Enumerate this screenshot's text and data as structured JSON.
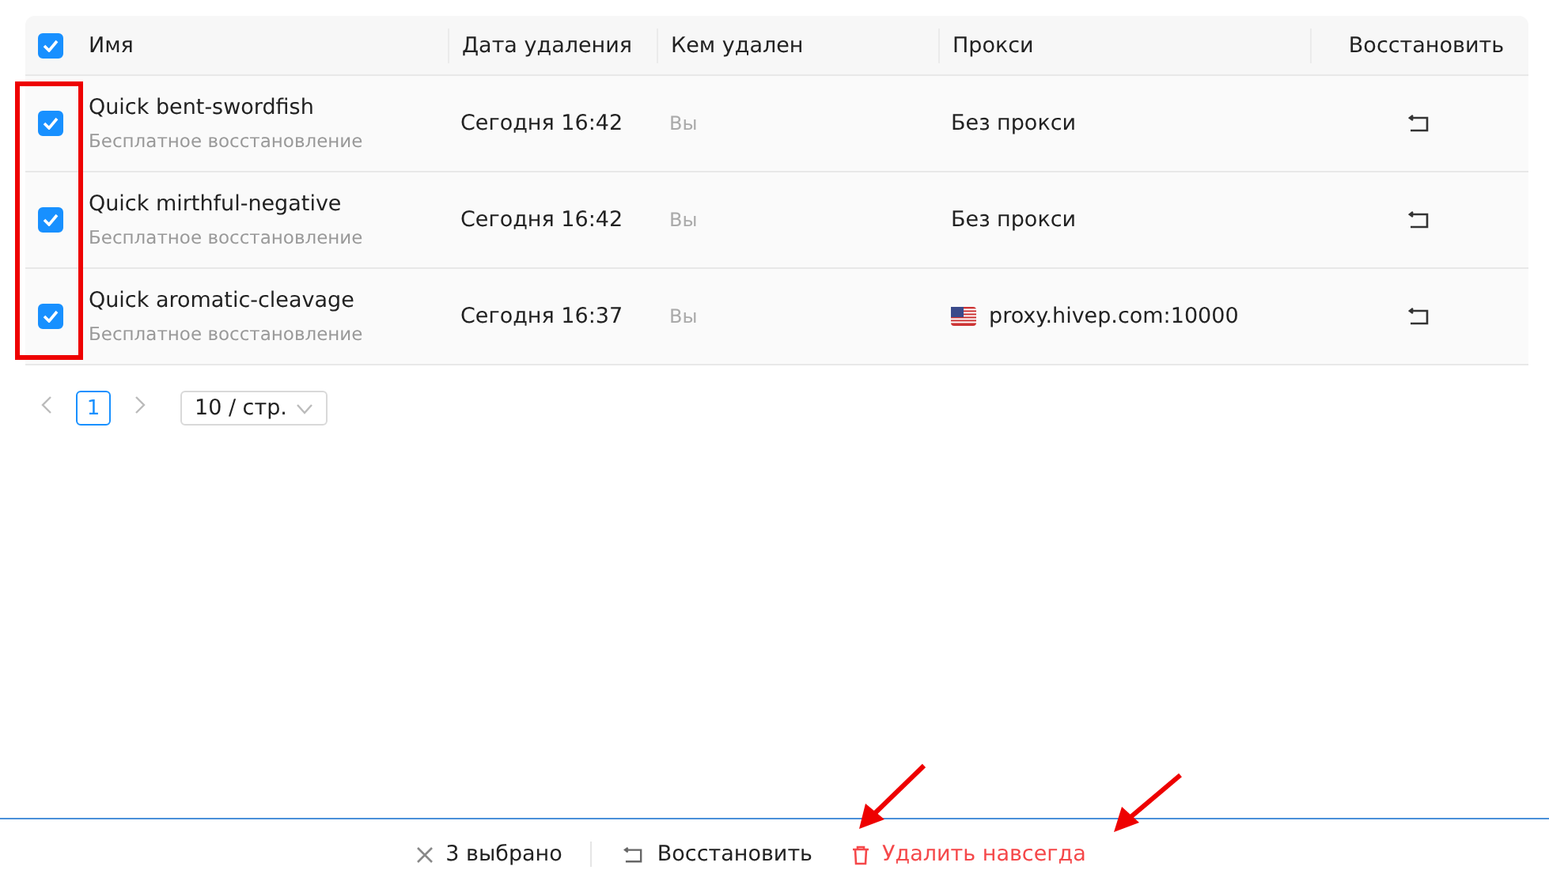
{
  "table": {
    "all_checked": true,
    "columns": [
      "Имя",
      "Дата удаления",
      "Кем удален",
      "Прокси",
      "Восстановить"
    ],
    "rows": [
      {
        "checked": true,
        "name": "Quick bent-swordfish",
        "note": "Бесплатное восстановление",
        "date": "Сегодня 16:42",
        "by": "Вы",
        "proxy": {
          "kind": "plain",
          "text": "Без прокси"
        }
      },
      {
        "checked": true,
        "name": "Quick mirthful-negative",
        "note": "Бесплатное восстановление",
        "date": "Сегодня 16:42",
        "by": "Вы",
        "proxy": {
          "kind": "plain",
          "text": "Без прокси"
        }
      },
      {
        "checked": true,
        "name": "Quick aromatic-cleavage",
        "note": "Бесплатное восстановление",
        "date": "Сегодня 16:37",
        "by": "Вы",
        "proxy": {
          "kind": "flag",
          "text": "proxy.hivep.com:10000"
        }
      }
    ]
  },
  "pagination": {
    "pages": [
      {
        "label": "1",
        "selected": true
      }
    ],
    "page_size": "10 / стр."
  },
  "action_bar": {
    "selected_count": "3 выбрано",
    "restore": "Восстановить",
    "delete": "Удалить навсегда"
  }
}
